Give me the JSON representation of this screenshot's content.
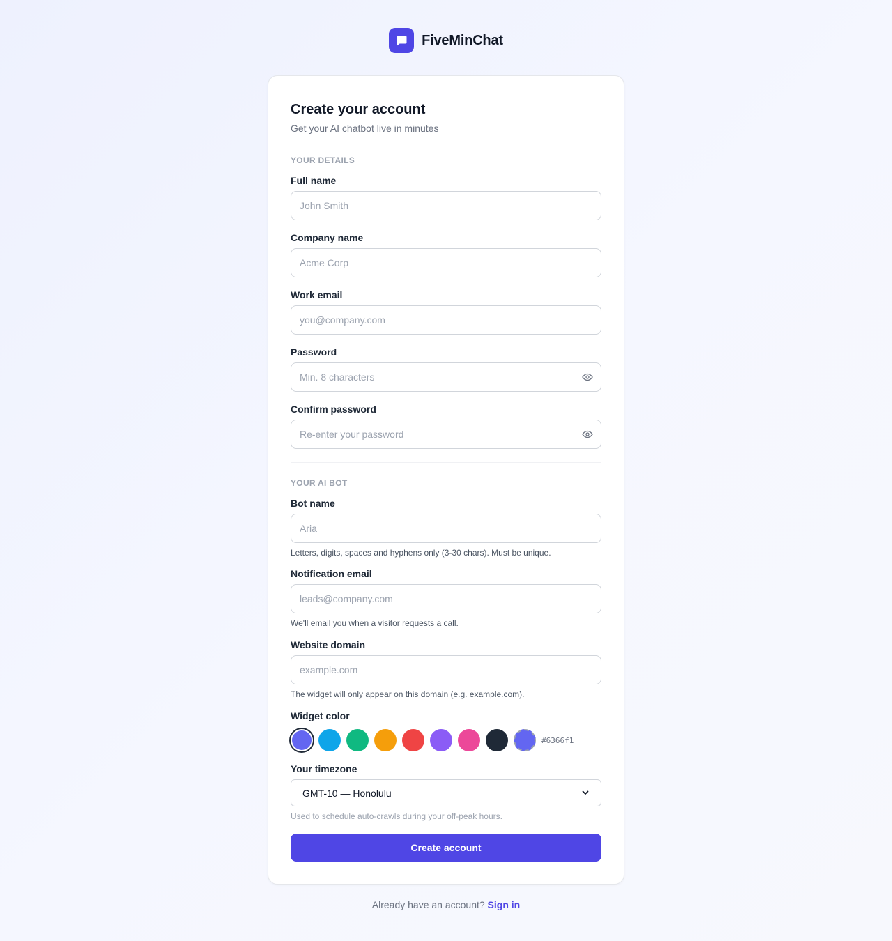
{
  "brand": {
    "name": "FiveMinChat",
    "icon": "chat-bubble-icon",
    "accent": "#4f46e5"
  },
  "card": {
    "title": "Create your account",
    "subtitle": "Get your AI chatbot live in minutes"
  },
  "details": {
    "section_label": "YOUR DETAILS",
    "full_name": {
      "label": "Full name",
      "placeholder": "John Smith",
      "value": ""
    },
    "company": {
      "label": "Company name",
      "placeholder": "Acme Corp",
      "value": ""
    },
    "email": {
      "label": "Work email",
      "placeholder": "you@company.com",
      "value": ""
    },
    "password": {
      "label": "Password",
      "placeholder": "Min. 8 characters",
      "value": ""
    },
    "confirm": {
      "label": "Confirm password",
      "placeholder": "Re-enter your password",
      "value": ""
    }
  },
  "bot": {
    "section_label": "YOUR AI BOT",
    "bot_name": {
      "label": "Bot name",
      "placeholder": "Aria",
      "value": "",
      "hint": "Letters, digits, spaces and hyphens only (3-30 chars). Must be unique."
    },
    "notify_email": {
      "label": "Notification email",
      "placeholder": "leads@company.com",
      "value": "",
      "hint": "We'll email you when a visitor requests a call."
    },
    "domain": {
      "label": "Website domain",
      "placeholder": "example.com",
      "value": "",
      "hint": "The widget will only appear on this domain (e.g. example.com)."
    },
    "widget_color": {
      "label": "Widget color",
      "swatches": [
        "#6366f1",
        "#0ea5e9",
        "#10b981",
        "#f59e0b",
        "#ef4444",
        "#8b5cf6",
        "#ec4899",
        "#1f2937"
      ],
      "selected": "#6366f1",
      "custom_color": "#6366f1",
      "hex_text": "#6366f1"
    },
    "timezone": {
      "label": "Your timezone",
      "selected": "GMT-10 — Honolulu",
      "hint": "Used to schedule auto-crawls during your off-peak hours."
    }
  },
  "submit_label": "Create account",
  "footer": {
    "text": "Already have an account?",
    "link": "Sign in"
  }
}
